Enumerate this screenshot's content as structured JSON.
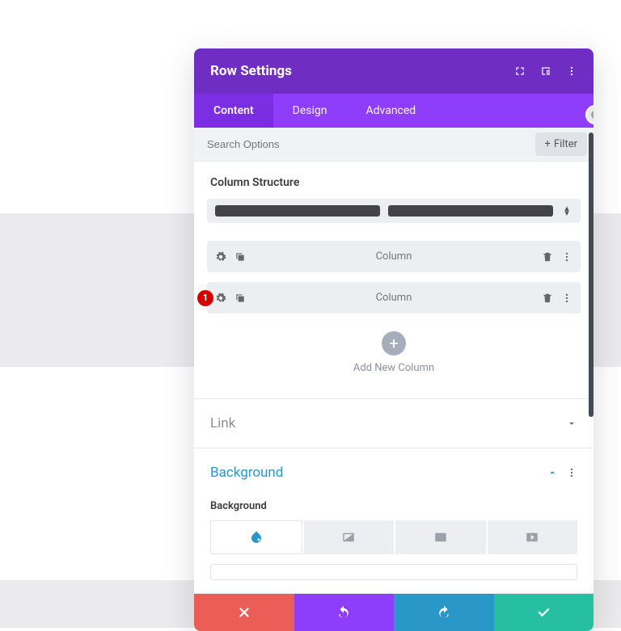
{
  "colors": {
    "accent": "#8e3dfa",
    "danger": "#eb5d57",
    "info": "#2a97c9",
    "success": "#26bfa1"
  },
  "header": {
    "title": "Row Settings",
    "actions": {
      "expand": "expand-icon",
      "responsive": "devices-icon",
      "more": "more-vert-icon"
    }
  },
  "tabs": [
    {
      "label": "Content",
      "active": true
    },
    {
      "label": "Design",
      "active": false
    },
    {
      "label": "Advanced",
      "active": false
    }
  ],
  "search": {
    "placeholder": "Search Options",
    "filter_label": "Filter"
  },
  "content": {
    "structure_label": "Column Structure",
    "columns": [
      {
        "label": "Column",
        "badge": null
      },
      {
        "label": "Column",
        "badge": "1"
      }
    ],
    "add_column_label": "Add New Column"
  },
  "accordions": [
    {
      "key": "link",
      "title": "Link",
      "open": false
    },
    {
      "key": "background",
      "title": "Background",
      "open": true,
      "section_label": "Background"
    }
  ],
  "footer": {
    "cancel": "close-icon",
    "undo": "undo-icon",
    "redo": "redo-icon",
    "save": "check-icon"
  }
}
